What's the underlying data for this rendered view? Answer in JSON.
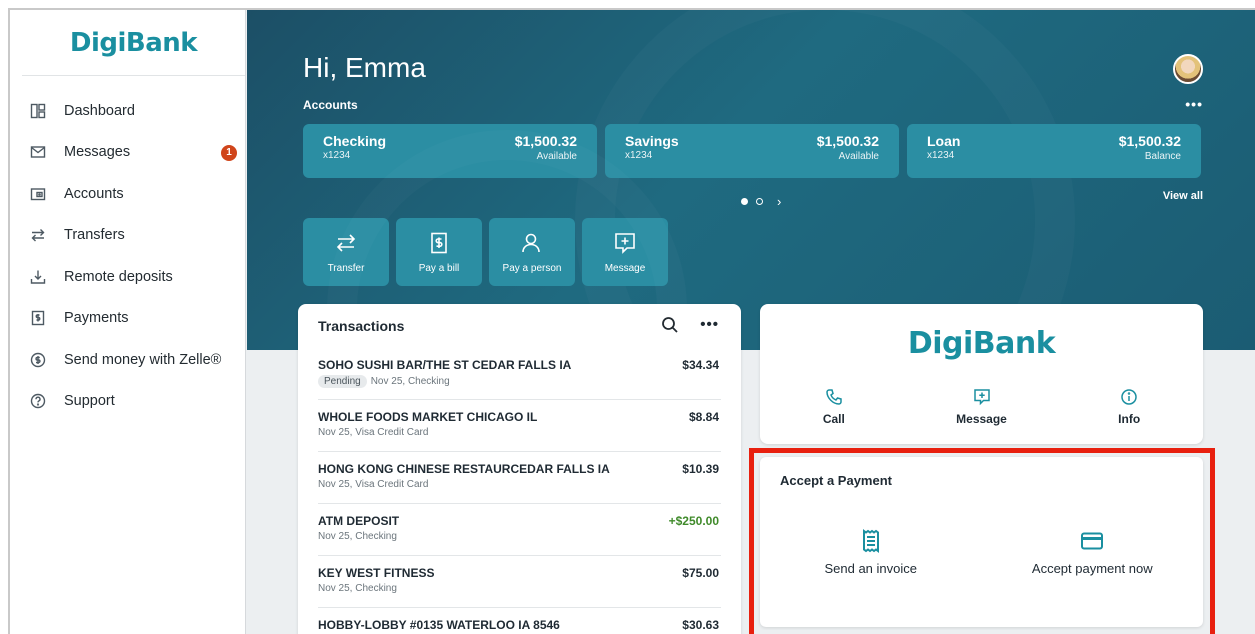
{
  "brand": {
    "name": "DigiBank",
    "color": "#1a8fa0"
  },
  "sidebar": {
    "items": [
      {
        "label": "Dashboard",
        "icon": "dashboard-icon"
      },
      {
        "label": "Messages",
        "icon": "envelope-icon",
        "badge": "1"
      },
      {
        "label": "Accounts",
        "icon": "wallet-icon"
      },
      {
        "label": "Transfers",
        "icon": "transfer-icon"
      },
      {
        "label": "Remote deposits",
        "icon": "deposit-icon"
      },
      {
        "label": "Payments",
        "icon": "bill-icon"
      },
      {
        "label": "Send money with Zelle®",
        "icon": "dollar-circle-icon"
      },
      {
        "label": "Support",
        "icon": "help-icon"
      }
    ]
  },
  "hero": {
    "greeting": "Hi, Emma",
    "accounts_label": "Accounts",
    "more": "•••",
    "view_all": "View all",
    "accounts": [
      {
        "name": "Checking",
        "number": "x1234",
        "amount": "$1,500.32",
        "sub": "Available"
      },
      {
        "name": "Savings",
        "number": "x1234",
        "amount": "$1,500.32",
        "sub": "Available"
      },
      {
        "name": "Loan",
        "number": "x1234",
        "amount": "$1,500.32",
        "sub": "Balance"
      }
    ],
    "pager_next": "›"
  },
  "quick_actions": [
    {
      "label": "Transfer",
      "icon": "transfer-icon"
    },
    {
      "label": "Pay a bill",
      "icon": "bill-icon"
    },
    {
      "label": "Pay a person",
      "icon": "person-icon"
    },
    {
      "label": "Message",
      "icon": "message-icon"
    }
  ],
  "transactions": {
    "title": "Transactions",
    "more": "•••",
    "rows": [
      {
        "name": "SOHO SUSHI BAR/THE ST CEDAR FALLS IA",
        "status": "Pending",
        "meta": "Nov 25, Checking",
        "amount": "$34.34"
      },
      {
        "name": "WHOLE FOODS MARKET CHICAGO IL",
        "meta": "Nov 25, Visa Credit Card",
        "amount": "$8.84"
      },
      {
        "name": "HONG KONG CHINESE RESTAURCEDAR FALLS IA",
        "meta": "Nov 25, Visa Credit Card",
        "amount": "$10.39"
      },
      {
        "name": "ATM DEPOSIT",
        "meta": "Nov 25, Checking",
        "amount": "+$250.00",
        "positive": true
      },
      {
        "name": "KEY WEST FITNESS",
        "meta": "Nov 25, Checking",
        "amount": "$75.00"
      },
      {
        "name": "HOBBY-LOBBY #0135 WATERLOO IA 8546",
        "meta": "",
        "amount": "$30.63"
      }
    ]
  },
  "bank_card": {
    "logo": "DigiBank",
    "actions": [
      {
        "label": "Call",
        "icon": "phone-icon"
      },
      {
        "label": "Message",
        "icon": "message-icon"
      },
      {
        "label": "Info",
        "icon": "info-icon"
      }
    ]
  },
  "accept_payment": {
    "title": "Accept a Payment",
    "actions": [
      {
        "label": "Send an invoice",
        "icon": "invoice-icon"
      },
      {
        "label": "Accept payment now",
        "icon": "credit-card-icon"
      }
    ],
    "highlight_color": "#e8200f"
  },
  "colors": {
    "hero": "#1f6a80",
    "tile": "#2b8ea3",
    "positive": "#3f8a2a",
    "badge": "#d0451b"
  }
}
